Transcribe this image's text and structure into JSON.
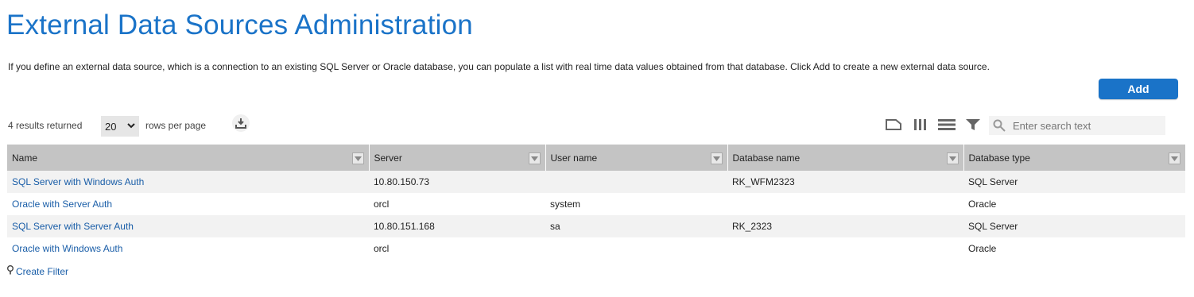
{
  "header": {
    "title": "External Data Sources Administration",
    "description": "If you define an external data source, which is a connection to an existing SQL Server or Oracle database, you can populate a list with real time data values obtained from that database. Click Add to create a new external data source."
  },
  "actions": {
    "add_label": "Add"
  },
  "paging": {
    "results_text": "4 results returned",
    "rows_per_page_value": "20",
    "rows_per_page_label": "rows per page"
  },
  "toolbar": {
    "icons": [
      "layout-icon",
      "columns-icon",
      "density-icon",
      "filter-icon",
      "search-icon",
      "download-icon"
    ],
    "search_placeholder": "Enter search text"
  },
  "table": {
    "columns": [
      "Name",
      "Server",
      "User name",
      "Database name",
      "Database type"
    ],
    "rows": [
      [
        "SQL Server with Windows Auth",
        "10.80.150.73",
        "",
        "RK_WFM2323",
        "SQL Server"
      ],
      [
        "Oracle with Server Auth",
        "orcl",
        "system",
        "",
        "Oracle"
      ],
      [
        "SQL Server with Server Auth",
        "10.80.151.168",
        "sa",
        "RK_2323",
        "SQL Server"
      ],
      [
        "Oracle with Windows Auth",
        "orcl",
        "",
        "",
        "Oracle"
      ]
    ]
  },
  "footer": {
    "create_filter_label": "Create Filter"
  },
  "colors": {
    "accent": "#1a73c8",
    "link": "#1a5ea8",
    "header_bg": "#c4c4c4",
    "row_alt": "#f2f2f2"
  }
}
